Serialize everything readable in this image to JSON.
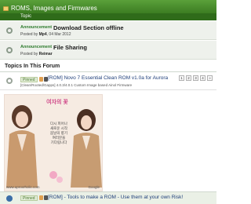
{
  "forum": {
    "title": "ROMS, Images and Firmwares",
    "column_header": "Topic"
  },
  "announcements": [
    {
      "kind": "Announcement",
      "title": "Download Section offline",
      "posted_by_label": "Posted by",
      "author": "Mp4",
      "date": ", 04 Mar 2012"
    },
    {
      "kind": "Announcement",
      "title": "File Sharing",
      "posted_by_label": "Posted by",
      "author": "Reimar",
      "date": ""
    }
  ],
  "topics_section_title": "Topics In This Forum",
  "threads": [
    {
      "badge": "Pinned",
      "title": "[ROM] Novo 7 Essential Clean ROM v1.0a for Aurora",
      "subtitle": "[Clean/Rooted/Gapps] 4.0.3/4.0.1 Custom Image based Ainol Firmware",
      "pages": [
        "1",
        "2",
        "3",
        "4",
        "»"
      ]
    },
    {
      "badge": "Pinned",
      "title": "[ROM] - Tools to make a ROM - Use them at your own Risk!",
      "subtitle": "",
      "pages": []
    }
  ],
  "ad": {
    "headline": "여자의 꽃",
    "body_lines": [
      "다시 피어나",
      "새로운 시작",
      "봄날의 향기",
      "여러분을",
      "기다립니다"
    ],
    "site": "www.uproxrholic.com",
    "provider": "Google"
  },
  "colors": {
    "header_green": "#3c7d22",
    "link_blue": "#1f3f7a",
    "announcement_green": "#2c7a2c"
  }
}
